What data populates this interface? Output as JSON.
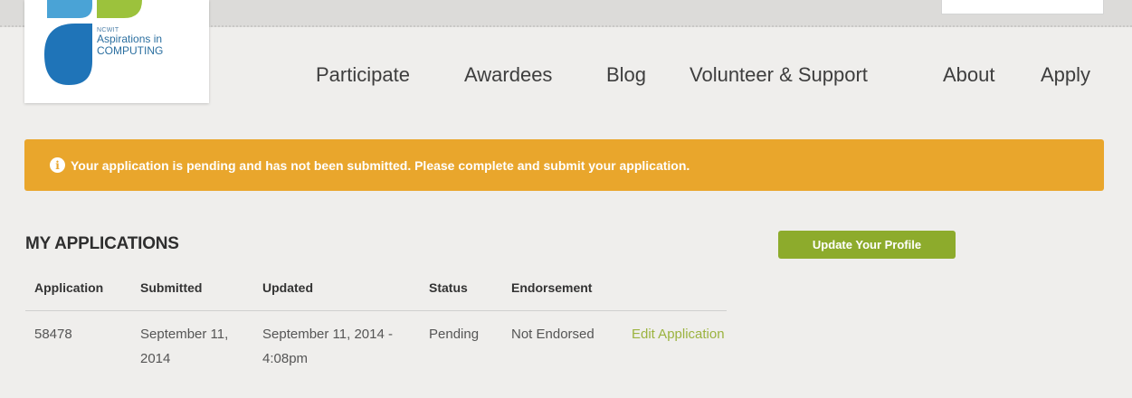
{
  "header": {
    "logo": {
      "org": "NCWIT",
      "line1": "Aspirations in",
      "line2": "COMPUTING"
    },
    "nav": [
      "Participate",
      "Awardees",
      "Blog",
      "Volunteer & Support",
      "About",
      "Apply"
    ]
  },
  "alert": {
    "icon": "info-icon",
    "icon_glyph": "i",
    "message": "Your application is pending and has not been submitted. Please complete and submit your application."
  },
  "applications": {
    "title": "MY APPLICATIONS",
    "profile_button": "Update Your Profile",
    "columns": [
      "Application",
      "Submitted",
      "Updated",
      "Status",
      "Endorsement"
    ],
    "rows": [
      {
        "application": "58478",
        "submitted": "September 11, 2014",
        "updated": "September 11, 2014 - 4:08pm",
        "status": "Pending",
        "endorsement": "Not Endorsed",
        "action": "Edit Application"
      }
    ]
  },
  "colors": {
    "alert_bg": "#e9a62c",
    "button_bg": "#8dab2c",
    "link": "#9bb33f",
    "logo_blue_dark": "#1f74b8",
    "logo_blue_light": "#4aa3d6",
    "logo_green": "#9cc23c"
  }
}
